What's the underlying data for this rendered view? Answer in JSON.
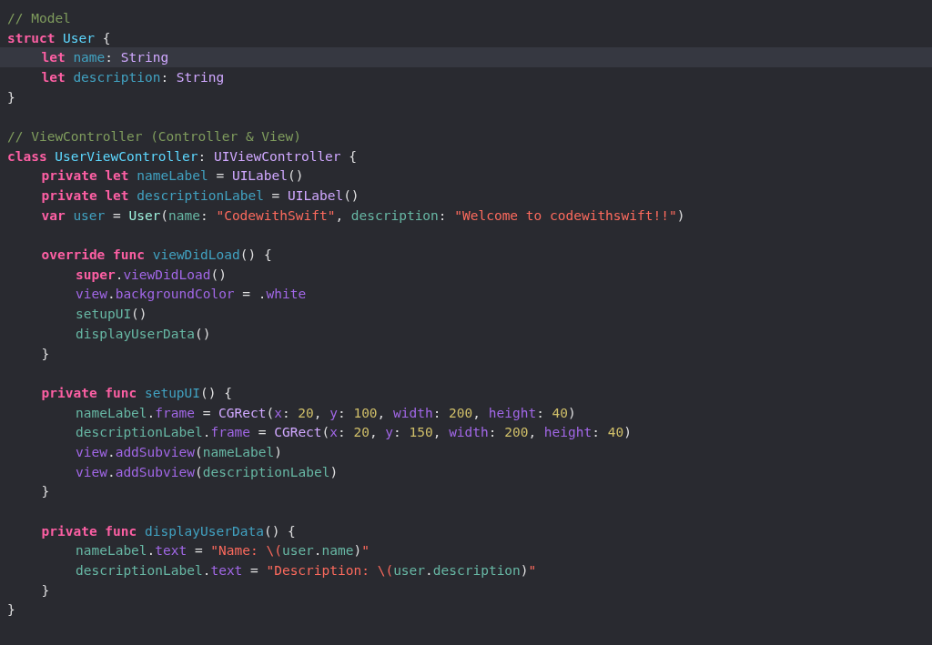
{
  "editor": {
    "lines": [
      {
        "kind": "code",
        "highlighted": false,
        "tokens": [
          {
            "t": "// Model",
            "kind": "comment"
          }
        ]
      },
      {
        "kind": "code",
        "highlighted": false,
        "tokens": [
          {
            "t": "struct",
            "kind": "keyword",
            "space_after": true
          },
          {
            "t": "User",
            "kind": "decl",
            "space_after": true
          },
          {
            "t": "{",
            "kind": "plain"
          }
        ],
        "children": [
          {
            "kind": "code",
            "highlighted": true,
            "tokens": [
              {
                "t": "let",
                "kind": "keyword",
                "space_after": true
              },
              {
                "t": "name",
                "kind": "decl2"
              },
              {
                "t": ":",
                "kind": "plain",
                "space_after": true
              },
              {
                "t": "String",
                "kind": "type"
              }
            ]
          },
          {
            "kind": "code",
            "highlighted": false,
            "tokens": [
              {
                "t": "let",
                "kind": "keyword",
                "space_after": true
              },
              {
                "t": "description",
                "kind": "decl2"
              },
              {
                "t": ":",
                "kind": "plain",
                "space_after": true
              },
              {
                "t": "String",
                "kind": "type"
              }
            ]
          }
        ]
      },
      {
        "kind": "code",
        "highlighted": false,
        "tokens": [
          {
            "t": "}",
            "kind": "plain"
          }
        ]
      },
      {
        "kind": "blank",
        "highlighted": false
      },
      {
        "kind": "code",
        "highlighted": false,
        "tokens": [
          {
            "t": "// ViewController (Controller & View)",
            "kind": "comment"
          }
        ]
      },
      {
        "kind": "code",
        "highlighted": false,
        "tokens": [
          {
            "t": "class",
            "kind": "keyword",
            "space_after": true
          },
          {
            "t": "UserViewController",
            "kind": "decl"
          },
          {
            "t": ":",
            "kind": "plain",
            "space_after": true
          },
          {
            "t": "UIViewController",
            "kind": "type",
            "space_after": true
          },
          {
            "t": "{",
            "kind": "plain"
          }
        ],
        "children": [
          {
            "kind": "code",
            "highlighted": false,
            "tokens": [
              {
                "t": "private let",
                "kind": "keyword",
                "space_after": true
              },
              {
                "t": "nameLabel",
                "kind": "decl2",
                "space_after": true
              },
              {
                "t": "=",
                "kind": "plain",
                "space_after": true
              },
              {
                "t": "UILabel",
                "kind": "type"
              },
              {
                "t": "()",
                "kind": "plain"
              }
            ]
          },
          {
            "kind": "code",
            "highlighted": false,
            "tokens": [
              {
                "t": "private let",
                "kind": "keyword",
                "space_after": true
              },
              {
                "t": "descriptionLabel",
                "kind": "decl2",
                "space_after": true
              },
              {
                "t": "=",
                "kind": "plain",
                "space_after": true
              },
              {
                "t": "UILabel",
                "kind": "type"
              },
              {
                "t": "()",
                "kind": "plain"
              }
            ]
          },
          {
            "kind": "code",
            "highlighted": false,
            "tokens": [
              {
                "t": "var",
                "kind": "keyword",
                "space_after": true
              },
              {
                "t": "user",
                "kind": "decl2",
                "space_after": true
              },
              {
                "t": "=",
                "kind": "plain",
                "space_after": true
              },
              {
                "t": "User",
                "kind": "proj"
              },
              {
                "t": "(",
                "kind": "plain"
              },
              {
                "t": "name",
                "kind": "proj2"
              },
              {
                "t": ":",
                "kind": "plain",
                "space_after": true
              },
              {
                "t": "\"CodewithSwift\"",
                "kind": "string"
              },
              {
                "t": ",",
                "kind": "plain",
                "space_after": true
              },
              {
                "t": "description",
                "kind": "proj2"
              },
              {
                "t": ":",
                "kind": "plain",
                "space_after": true
              },
              {
                "t": "\"Welcome to codewithswift!!\"",
                "kind": "string"
              },
              {
                "t": ")",
                "kind": "plain"
              }
            ]
          },
          {
            "kind": "blank",
            "highlighted": false
          },
          {
            "kind": "code",
            "highlighted": false,
            "tokens": [
              {
                "t": "override func",
                "kind": "keyword",
                "space_after": true
              },
              {
                "t": "viewDidLoad",
                "kind": "decl2"
              },
              {
                "t": "() {",
                "kind": "plain"
              }
            ],
            "children": [
              {
                "kind": "code",
                "highlighted": false,
                "tokens": [
                  {
                    "t": "super",
                    "kind": "keyword"
                  },
                  {
                    "t": ".",
                    "kind": "plain"
                  },
                  {
                    "t": "viewDidLoad",
                    "kind": "sys"
                  },
                  {
                    "t": "()",
                    "kind": "plain"
                  }
                ]
              },
              {
                "kind": "code",
                "highlighted": false,
                "tokens": [
                  {
                    "t": "view",
                    "kind": "sys"
                  },
                  {
                    "t": ".",
                    "kind": "plain"
                  },
                  {
                    "t": "backgroundColor",
                    "kind": "sys",
                    "space_after": true
                  },
                  {
                    "t": "= .",
                    "kind": "plain"
                  },
                  {
                    "t": "white",
                    "kind": "sys"
                  }
                ]
              },
              {
                "kind": "code",
                "highlighted": false,
                "tokens": [
                  {
                    "t": "setupUI",
                    "kind": "proj2"
                  },
                  {
                    "t": "()",
                    "kind": "plain"
                  }
                ]
              },
              {
                "kind": "code",
                "highlighted": false,
                "tokens": [
                  {
                    "t": "displayUserData",
                    "kind": "proj2"
                  },
                  {
                    "t": "()",
                    "kind": "plain"
                  }
                ]
              }
            ]
          },
          {
            "kind": "code",
            "highlighted": false,
            "tokens": [
              {
                "t": "}",
                "kind": "plain"
              }
            ]
          },
          {
            "kind": "blank",
            "highlighted": false
          },
          {
            "kind": "code",
            "highlighted": false,
            "tokens": [
              {
                "t": "private func",
                "kind": "keyword",
                "space_after": true
              },
              {
                "t": "setupUI",
                "kind": "decl2"
              },
              {
                "t": "() {",
                "kind": "plain"
              }
            ],
            "children": [
              {
                "kind": "code",
                "highlighted": false,
                "tokens": [
                  {
                    "t": "nameLabel",
                    "kind": "proj2"
                  },
                  {
                    "t": ".",
                    "kind": "plain"
                  },
                  {
                    "t": "frame",
                    "kind": "sys",
                    "space_after": true
                  },
                  {
                    "t": "=",
                    "kind": "plain",
                    "space_after": true
                  },
                  {
                    "t": "CGRect",
                    "kind": "type"
                  },
                  {
                    "t": "(",
                    "kind": "plain"
                  },
                  {
                    "t": "x",
                    "kind": "sys"
                  },
                  {
                    "t": ":",
                    "kind": "plain",
                    "space_after": true
                  },
                  {
                    "t": "20",
                    "kind": "number"
                  },
                  {
                    "t": ",",
                    "kind": "plain",
                    "space_after": true
                  },
                  {
                    "t": "y",
                    "kind": "sys"
                  },
                  {
                    "t": ":",
                    "kind": "plain",
                    "space_after": true
                  },
                  {
                    "t": "100",
                    "kind": "number"
                  },
                  {
                    "t": ",",
                    "kind": "plain",
                    "space_after": true
                  },
                  {
                    "t": "width",
                    "kind": "sys"
                  },
                  {
                    "t": ":",
                    "kind": "plain",
                    "space_after": true
                  },
                  {
                    "t": "200",
                    "kind": "number"
                  },
                  {
                    "t": ",",
                    "kind": "plain",
                    "space_after": true
                  },
                  {
                    "t": "height",
                    "kind": "sys"
                  },
                  {
                    "t": ":",
                    "kind": "plain",
                    "space_after": true
                  },
                  {
                    "t": "40",
                    "kind": "number"
                  },
                  {
                    "t": ")",
                    "kind": "plain"
                  }
                ]
              },
              {
                "kind": "code",
                "highlighted": false,
                "tokens": [
                  {
                    "t": "descriptionLabel",
                    "kind": "proj2"
                  },
                  {
                    "t": ".",
                    "kind": "plain"
                  },
                  {
                    "t": "frame",
                    "kind": "sys",
                    "space_after": true
                  },
                  {
                    "t": "=",
                    "kind": "plain",
                    "space_after": true
                  },
                  {
                    "t": "CGRect",
                    "kind": "type"
                  },
                  {
                    "t": "(",
                    "kind": "plain"
                  },
                  {
                    "t": "x",
                    "kind": "sys"
                  },
                  {
                    "t": ":",
                    "kind": "plain",
                    "space_after": true
                  },
                  {
                    "t": "20",
                    "kind": "number"
                  },
                  {
                    "t": ",",
                    "kind": "plain",
                    "space_after": true
                  },
                  {
                    "t": "y",
                    "kind": "sys"
                  },
                  {
                    "t": ":",
                    "kind": "plain",
                    "space_after": true
                  },
                  {
                    "t": "150",
                    "kind": "number"
                  },
                  {
                    "t": ",",
                    "kind": "plain",
                    "space_after": true
                  },
                  {
                    "t": "width",
                    "kind": "sys"
                  },
                  {
                    "t": ":",
                    "kind": "plain",
                    "space_after": true
                  },
                  {
                    "t": "200",
                    "kind": "number"
                  },
                  {
                    "t": ",",
                    "kind": "plain",
                    "space_after": true
                  },
                  {
                    "t": "height",
                    "kind": "sys"
                  },
                  {
                    "t": ":",
                    "kind": "plain",
                    "space_after": true
                  },
                  {
                    "t": "40",
                    "kind": "number"
                  },
                  {
                    "t": ")",
                    "kind": "plain"
                  }
                ]
              },
              {
                "kind": "code",
                "highlighted": false,
                "tokens": [
                  {
                    "t": "view",
                    "kind": "sys"
                  },
                  {
                    "t": ".",
                    "kind": "plain"
                  },
                  {
                    "t": "addSubview",
                    "kind": "sys"
                  },
                  {
                    "t": "(",
                    "kind": "plain"
                  },
                  {
                    "t": "nameLabel",
                    "kind": "proj2"
                  },
                  {
                    "t": ")",
                    "kind": "plain"
                  }
                ]
              },
              {
                "kind": "code",
                "highlighted": false,
                "tokens": [
                  {
                    "t": "view",
                    "kind": "sys"
                  },
                  {
                    "t": ".",
                    "kind": "plain"
                  },
                  {
                    "t": "addSubview",
                    "kind": "sys"
                  },
                  {
                    "t": "(",
                    "kind": "plain"
                  },
                  {
                    "t": "descriptionLabel",
                    "kind": "proj2"
                  },
                  {
                    "t": ")",
                    "kind": "plain"
                  }
                ]
              }
            ]
          },
          {
            "kind": "code",
            "highlighted": false,
            "tokens": [
              {
                "t": "}",
                "kind": "plain"
              }
            ]
          },
          {
            "kind": "blank",
            "highlighted": false
          },
          {
            "kind": "code",
            "highlighted": false,
            "tokens": [
              {
                "t": "private func",
                "kind": "keyword",
                "space_after": true
              },
              {
                "t": "displayUserData",
                "kind": "decl2"
              },
              {
                "t": "() {",
                "kind": "plain"
              }
            ],
            "children": [
              {
                "kind": "code",
                "highlighted": false,
                "tokens": [
                  {
                    "t": "nameLabel",
                    "kind": "proj2"
                  },
                  {
                    "t": ".",
                    "kind": "plain"
                  },
                  {
                    "t": "text",
                    "kind": "sys",
                    "space_after": true
                  },
                  {
                    "t": "=",
                    "kind": "plain",
                    "space_after": true
                  },
                  {
                    "t": "\"Name: \\(",
                    "kind": "string"
                  },
                  {
                    "t": "user",
                    "kind": "proj2"
                  },
                  {
                    "t": ".",
                    "kind": "plain"
                  },
                  {
                    "t": "name",
                    "kind": "proj2"
                  },
                  {
                    "t": ")",
                    "kind": "plain"
                  },
                  {
                    "t": "\"",
                    "kind": "string"
                  }
                ]
              },
              {
                "kind": "code",
                "highlighted": false,
                "tokens": [
                  {
                    "t": "descriptionLabel",
                    "kind": "proj2"
                  },
                  {
                    "t": ".",
                    "kind": "plain"
                  },
                  {
                    "t": "text",
                    "kind": "sys",
                    "space_after": true
                  },
                  {
                    "t": "=",
                    "kind": "plain",
                    "space_after": true
                  },
                  {
                    "t": "\"Description: \\(",
                    "kind": "string"
                  },
                  {
                    "t": "user",
                    "kind": "proj2"
                  },
                  {
                    "t": ".",
                    "kind": "plain"
                  },
                  {
                    "t": "description",
                    "kind": "proj2"
                  },
                  {
                    "t": ")",
                    "kind": "plain"
                  },
                  {
                    "t": "\"",
                    "kind": "string"
                  }
                ]
              }
            ]
          },
          {
            "kind": "code",
            "highlighted": false,
            "tokens": [
              {
                "t": "}",
                "kind": "plain"
              }
            ]
          }
        ]
      },
      {
        "kind": "code",
        "highlighted": false,
        "tokens": [
          {
            "t": "}",
            "kind": "plain"
          }
        ]
      }
    ]
  }
}
